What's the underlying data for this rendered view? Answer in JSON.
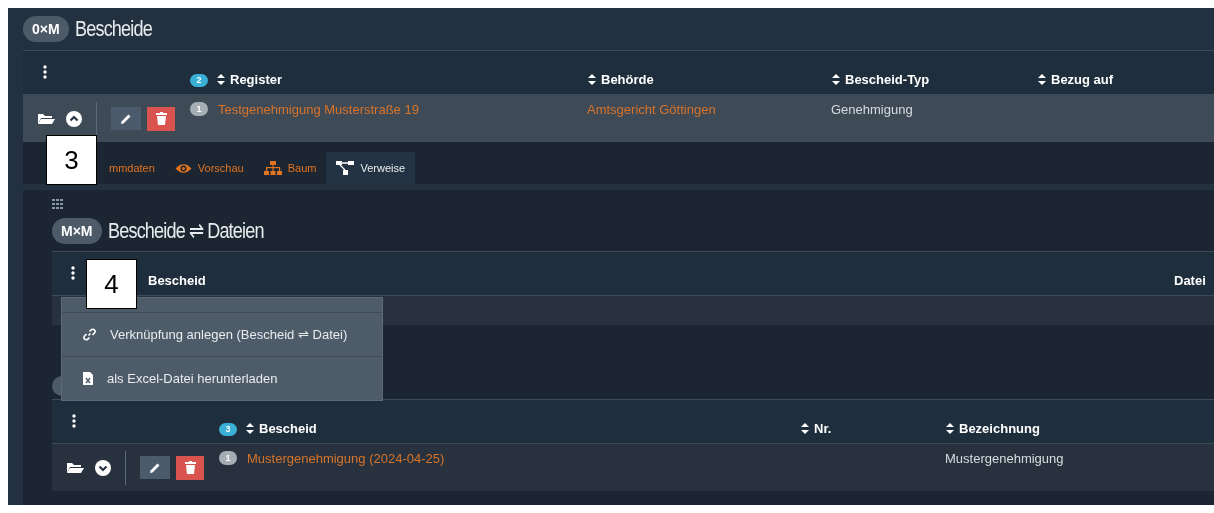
{
  "main": {
    "badge": "0×M",
    "title": "Bescheide",
    "table": {
      "count": "2",
      "columns": [
        {
          "label": "Register",
          "sortable": true
        },
        {
          "label": "Behörde",
          "sortable": true
        },
        {
          "label": "Bescheid-Typ",
          "sortable": true
        },
        {
          "label": "Bezug auf",
          "sortable": true
        }
      ],
      "rows": [
        {
          "index": "1",
          "expanded": true,
          "cells": [
            {
              "text": "Testgenehmigung Musterstraße 19",
              "link": true
            },
            {
              "text": "Amtsgericht Göttingen",
              "link": true
            },
            {
              "text": "Genehmigung",
              "link": false
            },
            {}
          ]
        }
      ]
    }
  },
  "detail_tabs": [
    {
      "label": "mmdaten",
      "selected": false
    },
    {
      "label": "Vorschau",
      "selected": false
    },
    {
      "label": "Baum",
      "selected": false
    },
    {
      "label": "Verweise",
      "selected": true
    }
  ],
  "relations": {
    "badge": "M×M",
    "title": "Bescheide ⇌ Dateien",
    "table": {
      "columns": [
        {
          "label": "Bescheid",
          "sortable": false
        },
        {
          "label": "Datei",
          "sortable": false
        }
      ]
    }
  },
  "chapters": {
    "table": {
      "count": "3",
      "columns": [
        {
          "label": "Bescheid",
          "sortable": true
        },
        {
          "label": "Nr.",
          "sortable": true
        },
        {
          "label": "Bezeichnung",
          "sortable": true
        }
      ],
      "rows": [
        {
          "index": "1",
          "expanded": false,
          "cells": [
            {
              "text": "Mustergenehmigung (2024-04-25)",
              "link": true
            },
            {},
            {
              "text": "Mustergenehmigung",
              "link": false
            }
          ]
        }
      ]
    }
  },
  "context_menu": [
    {
      "label": "Verknüpfung anlegen (Bescheid ⇌ Datei)"
    },
    {
      "label": "als Excel-Datei herunterladen"
    }
  ],
  "callouts": [
    "3",
    "4"
  ]
}
